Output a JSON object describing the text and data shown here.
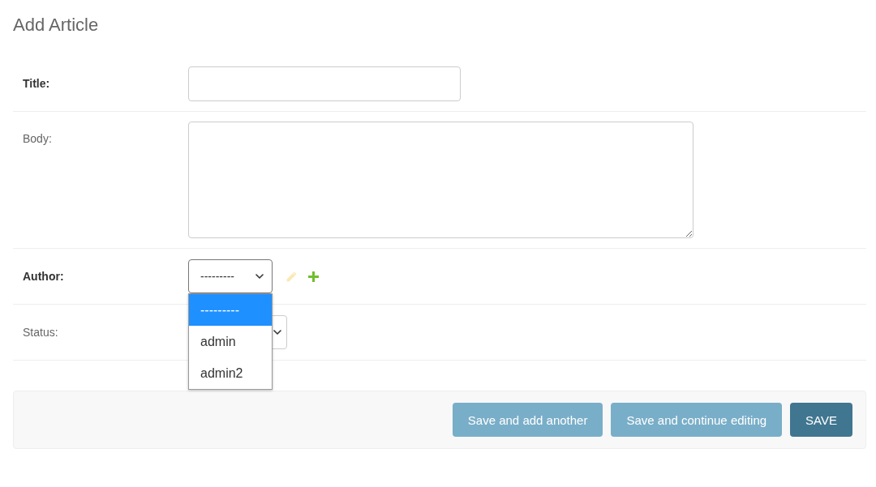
{
  "page": {
    "title": "Add Article"
  },
  "fields": [
    {
      "label": "Title:",
      "required": true,
      "kind": "text"
    },
    {
      "label": "Body:",
      "required": false,
      "kind": "textarea"
    },
    {
      "label": "Author:",
      "required": true,
      "kind": "select",
      "value": "---------",
      "open": true,
      "options": [
        {
          "label": "---------",
          "selected": true
        },
        {
          "label": "admin",
          "selected": false
        },
        {
          "label": "admin2",
          "selected": false
        }
      ],
      "actions": [
        {
          "kind": "change",
          "disabled": true
        },
        {
          "kind": "add",
          "disabled": false
        }
      ]
    },
    {
      "label": "Status:",
      "required": false,
      "kind": "select",
      "open": false
    }
  ],
  "buttons": [
    {
      "label": "Save and add another",
      "kind": "secondary"
    },
    {
      "label": "Save and continue editing",
      "kind": "secondary"
    },
    {
      "label": "SAVE",
      "kind": "default"
    }
  ]
}
